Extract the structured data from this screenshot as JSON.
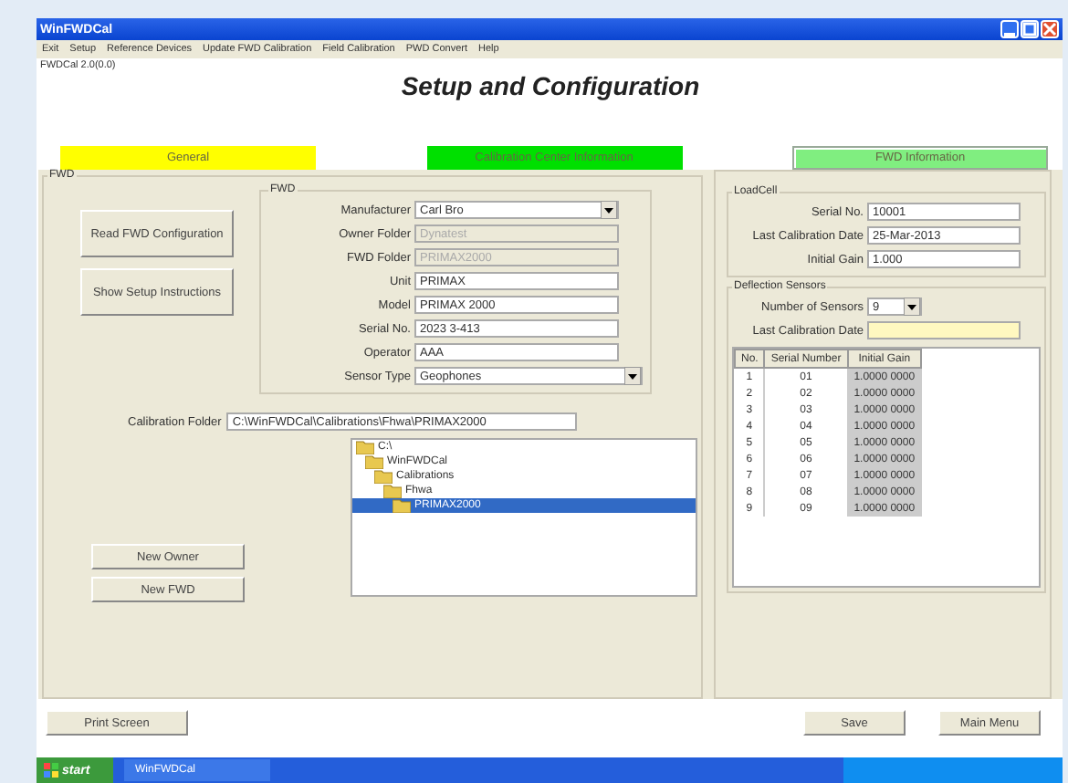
{
  "window": {
    "title": "WinFWDCal"
  },
  "menu": [
    "Exit",
    "Setup",
    "Reference Devices",
    "Update FWD Calibration",
    "Field Calibration",
    "PWD Convert",
    "Help"
  ],
  "version": "FWDCal 2.0(0.0)",
  "heading": "Setup and Configuration",
  "tabs": [
    {
      "label": "General",
      "color": "#ffff00",
      "selected": false
    },
    {
      "label": "Calibration Center Information",
      "color": "#00e000",
      "selected": false
    },
    {
      "label": "FWD Information",
      "color": "#80ee80",
      "selected": true
    }
  ],
  "fwd_group": {
    "title": "FWD",
    "buttons": [
      "Read FWD Configuration",
      "Show Setup Instructions"
    ],
    "inner_title": "FWD",
    "fields": [
      {
        "label": "Manufacturer",
        "value": "Carl Bro",
        "kind": "dropdown",
        "disabled": false
      },
      {
        "label": "Owner Folder",
        "value": "Dynatest",
        "kind": "text",
        "disabled": true
      },
      {
        "label": "FWD Folder",
        "value": "PRIMAX2000",
        "kind": "text",
        "disabled": true
      },
      {
        "label": "Unit",
        "value": "PRIMAX",
        "kind": "text",
        "disabled": false
      },
      {
        "label": "Model",
        "value": "PRIMAX 2000",
        "kind": "text",
        "disabled": false
      },
      {
        "label": "Serial No.",
        "value": "2023 3-413",
        "kind": "text",
        "disabled": false
      },
      {
        "label": "Operator",
        "value": "AAA",
        "kind": "text",
        "disabled": false
      },
      {
        "label": "Sensor Type",
        "value": "Geophones",
        "kind": "dropdown",
        "disabled": false
      }
    ],
    "calibration_folder": {
      "label": "Calibration Folder",
      "value": "C:\\WinFWDCal\\Calibrations\\Fhwa\\PRIMAX2000"
    },
    "tree": [
      {
        "label": "C:\\",
        "selected": false,
        "children": [
          {
            "label": "WinFWDCal",
            "selected": false,
            "children": [
              {
                "label": "Calibrations",
                "selected": false,
                "children": [
                  {
                    "label": "Fhwa",
                    "selected": false,
                    "children": [
                      {
                        "label": "PRIMAX2000",
                        "selected": true
                      }
                    ]
                  }
                ]
              }
            ]
          }
        ]
      }
    ],
    "lower_buttons": [
      "New Owner",
      "New FWD"
    ]
  },
  "loadcell": {
    "title": "LoadCell",
    "fields": [
      {
        "label": "Serial No.",
        "value": "10001"
      },
      {
        "label": "Last Calibration Date",
        "value": "25-Mar-2013"
      },
      {
        "label": "Initial Gain",
        "value": "1.000"
      }
    ]
  },
  "deflection": {
    "title": "Deflection Sensors",
    "sensors_label": "Number of Sensors",
    "sensors_value": "9",
    "date_label": "Last Calibration Date",
    "table": {
      "columns": [
        "No.",
        "Serial Number",
        "Initial Gain"
      ],
      "rows": [
        [
          "1",
          "01",
          "1.0000 0000"
        ],
        [
          "2",
          "02",
          "1.0000 0000"
        ],
        [
          "3",
          "03",
          "1.0000 0000"
        ],
        [
          "4",
          "04",
          "1.0000 0000"
        ],
        [
          "5",
          "05",
          "1.0000 0000"
        ],
        [
          "6",
          "06",
          "1.0000 0000"
        ],
        [
          "7",
          "07",
          "1.0000 0000"
        ],
        [
          "8",
          "08",
          "1.0000 0000"
        ],
        [
          "9",
          "09",
          "1.0000 0000"
        ]
      ]
    }
  },
  "bottom_buttons": [
    {
      "label": "Print Screen",
      "kind": "left"
    },
    {
      "label": "Save",
      "kind": "right"
    },
    {
      "label": "Main Menu",
      "kind": "right"
    }
  ],
  "taskbar": {
    "start": "start",
    "task": "WinFWDCal"
  }
}
